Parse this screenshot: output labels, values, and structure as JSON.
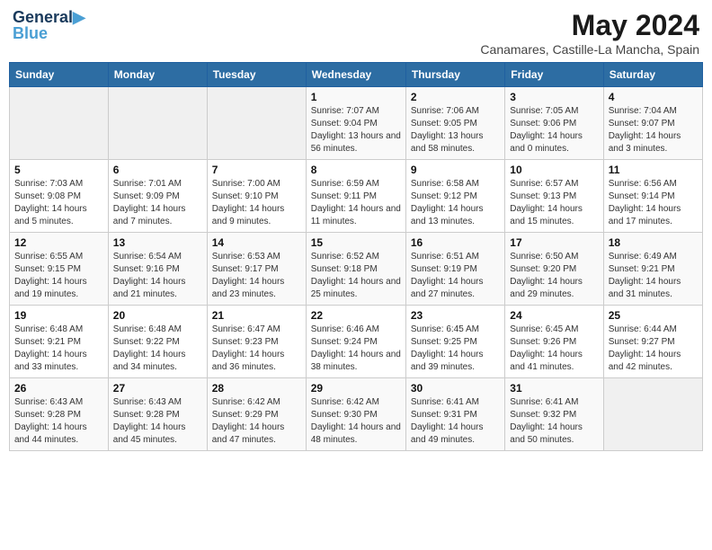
{
  "header": {
    "logo_line1": "General",
    "logo_line2": "Blue",
    "month": "May 2024",
    "location": "Canamares, Castille-La Mancha, Spain"
  },
  "weekdays": [
    "Sunday",
    "Monday",
    "Tuesday",
    "Wednesday",
    "Thursday",
    "Friday",
    "Saturday"
  ],
  "weeks": [
    [
      {
        "day": "",
        "sunrise": "",
        "sunset": "",
        "daylight": "",
        "empty": true
      },
      {
        "day": "",
        "sunrise": "",
        "sunset": "",
        "daylight": "",
        "empty": true
      },
      {
        "day": "",
        "sunrise": "",
        "sunset": "",
        "daylight": "",
        "empty": true
      },
      {
        "day": "1",
        "sunrise": "Sunrise: 7:07 AM",
        "sunset": "Sunset: 9:04 PM",
        "daylight": "Daylight: 13 hours and 56 minutes."
      },
      {
        "day": "2",
        "sunrise": "Sunrise: 7:06 AM",
        "sunset": "Sunset: 9:05 PM",
        "daylight": "Daylight: 13 hours and 58 minutes."
      },
      {
        "day": "3",
        "sunrise": "Sunrise: 7:05 AM",
        "sunset": "Sunset: 9:06 PM",
        "daylight": "Daylight: 14 hours and 0 minutes."
      },
      {
        "day": "4",
        "sunrise": "Sunrise: 7:04 AM",
        "sunset": "Sunset: 9:07 PM",
        "daylight": "Daylight: 14 hours and 3 minutes."
      }
    ],
    [
      {
        "day": "5",
        "sunrise": "Sunrise: 7:03 AM",
        "sunset": "Sunset: 9:08 PM",
        "daylight": "Daylight: 14 hours and 5 minutes."
      },
      {
        "day": "6",
        "sunrise": "Sunrise: 7:01 AM",
        "sunset": "Sunset: 9:09 PM",
        "daylight": "Daylight: 14 hours and 7 minutes."
      },
      {
        "day": "7",
        "sunrise": "Sunrise: 7:00 AM",
        "sunset": "Sunset: 9:10 PM",
        "daylight": "Daylight: 14 hours and 9 minutes."
      },
      {
        "day": "8",
        "sunrise": "Sunrise: 6:59 AM",
        "sunset": "Sunset: 9:11 PM",
        "daylight": "Daylight: 14 hours and 11 minutes."
      },
      {
        "day": "9",
        "sunrise": "Sunrise: 6:58 AM",
        "sunset": "Sunset: 9:12 PM",
        "daylight": "Daylight: 14 hours and 13 minutes."
      },
      {
        "day": "10",
        "sunrise": "Sunrise: 6:57 AM",
        "sunset": "Sunset: 9:13 PM",
        "daylight": "Daylight: 14 hours and 15 minutes."
      },
      {
        "day": "11",
        "sunrise": "Sunrise: 6:56 AM",
        "sunset": "Sunset: 9:14 PM",
        "daylight": "Daylight: 14 hours and 17 minutes."
      }
    ],
    [
      {
        "day": "12",
        "sunrise": "Sunrise: 6:55 AM",
        "sunset": "Sunset: 9:15 PM",
        "daylight": "Daylight: 14 hours and 19 minutes."
      },
      {
        "day": "13",
        "sunrise": "Sunrise: 6:54 AM",
        "sunset": "Sunset: 9:16 PM",
        "daylight": "Daylight: 14 hours and 21 minutes."
      },
      {
        "day": "14",
        "sunrise": "Sunrise: 6:53 AM",
        "sunset": "Sunset: 9:17 PM",
        "daylight": "Daylight: 14 hours and 23 minutes."
      },
      {
        "day": "15",
        "sunrise": "Sunrise: 6:52 AM",
        "sunset": "Sunset: 9:18 PM",
        "daylight": "Daylight: 14 hours and 25 minutes."
      },
      {
        "day": "16",
        "sunrise": "Sunrise: 6:51 AM",
        "sunset": "Sunset: 9:19 PM",
        "daylight": "Daylight: 14 hours and 27 minutes."
      },
      {
        "day": "17",
        "sunrise": "Sunrise: 6:50 AM",
        "sunset": "Sunset: 9:20 PM",
        "daylight": "Daylight: 14 hours and 29 minutes."
      },
      {
        "day": "18",
        "sunrise": "Sunrise: 6:49 AM",
        "sunset": "Sunset: 9:21 PM",
        "daylight": "Daylight: 14 hours and 31 minutes."
      }
    ],
    [
      {
        "day": "19",
        "sunrise": "Sunrise: 6:48 AM",
        "sunset": "Sunset: 9:21 PM",
        "daylight": "Daylight: 14 hours and 33 minutes."
      },
      {
        "day": "20",
        "sunrise": "Sunrise: 6:48 AM",
        "sunset": "Sunset: 9:22 PM",
        "daylight": "Daylight: 14 hours and 34 minutes."
      },
      {
        "day": "21",
        "sunrise": "Sunrise: 6:47 AM",
        "sunset": "Sunset: 9:23 PM",
        "daylight": "Daylight: 14 hours and 36 minutes."
      },
      {
        "day": "22",
        "sunrise": "Sunrise: 6:46 AM",
        "sunset": "Sunset: 9:24 PM",
        "daylight": "Daylight: 14 hours and 38 minutes."
      },
      {
        "day": "23",
        "sunrise": "Sunrise: 6:45 AM",
        "sunset": "Sunset: 9:25 PM",
        "daylight": "Daylight: 14 hours and 39 minutes."
      },
      {
        "day": "24",
        "sunrise": "Sunrise: 6:45 AM",
        "sunset": "Sunset: 9:26 PM",
        "daylight": "Daylight: 14 hours and 41 minutes."
      },
      {
        "day": "25",
        "sunrise": "Sunrise: 6:44 AM",
        "sunset": "Sunset: 9:27 PM",
        "daylight": "Daylight: 14 hours and 42 minutes."
      }
    ],
    [
      {
        "day": "26",
        "sunrise": "Sunrise: 6:43 AM",
        "sunset": "Sunset: 9:28 PM",
        "daylight": "Daylight: 14 hours and 44 minutes."
      },
      {
        "day": "27",
        "sunrise": "Sunrise: 6:43 AM",
        "sunset": "Sunset: 9:28 PM",
        "daylight": "Daylight: 14 hours and 45 minutes."
      },
      {
        "day": "28",
        "sunrise": "Sunrise: 6:42 AM",
        "sunset": "Sunset: 9:29 PM",
        "daylight": "Daylight: 14 hours and 47 minutes."
      },
      {
        "day": "29",
        "sunrise": "Sunrise: 6:42 AM",
        "sunset": "Sunset: 9:30 PM",
        "daylight": "Daylight: 14 hours and 48 minutes."
      },
      {
        "day": "30",
        "sunrise": "Sunrise: 6:41 AM",
        "sunset": "Sunset: 9:31 PM",
        "daylight": "Daylight: 14 hours and 49 minutes."
      },
      {
        "day": "31",
        "sunrise": "Sunrise: 6:41 AM",
        "sunset": "Sunset: 9:32 PM",
        "daylight": "Daylight: 14 hours and 50 minutes."
      },
      {
        "day": "",
        "sunrise": "",
        "sunset": "",
        "daylight": "",
        "empty": true
      }
    ]
  ]
}
